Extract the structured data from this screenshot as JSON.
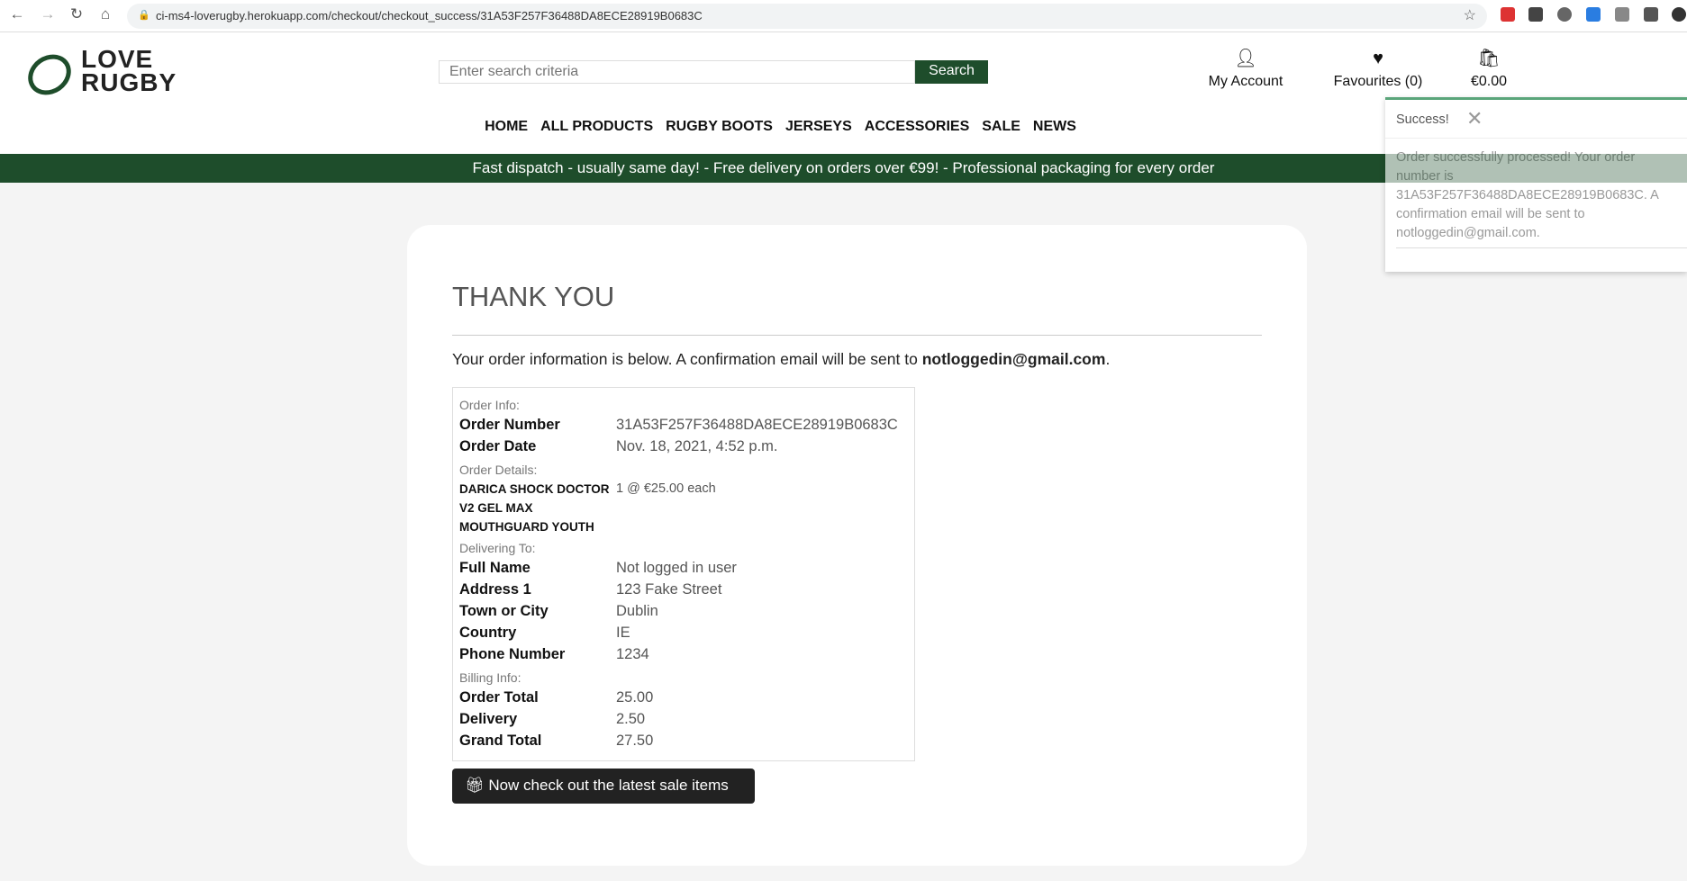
{
  "browser": {
    "url": "ci-ms4-loverugby.herokuapp.com/checkout/checkout_success/31A53F257F36488DA8ECE28919B0683C"
  },
  "header": {
    "logo": "LOVE RUGBY",
    "logo_line1": "LOVE",
    "logo_line2": "RUGBY",
    "search_placeholder": "Enter search criteria",
    "search_label": "Search",
    "account": "My Account",
    "favourites": "Favourites (0)",
    "cart": "€0.00"
  },
  "nav": [
    "HOME",
    "ALL PRODUCTS",
    "RUGBY BOOTS",
    "JERSEYS",
    "ACCESSORIES",
    "SALE",
    "NEWS"
  ],
  "banner": "Fast dispatch - usually same day! - Free delivery on orders over €99! - Professional packaging for every order",
  "main": {
    "title": "THANK YOU",
    "intro": "Your order information is below. A confirmation email will be sent to ",
    "email": "notloggedin@gmail.com",
    "intro_end": ".",
    "order_info": "Order Info:",
    "order_number_label": "Order Number",
    "order_number": "31A53F257F36488DA8ECE28919B0683C",
    "order_date_label": "Order Date",
    "order_date": "Nov. 18, 2021, 4:52 p.m.",
    "order_details": "Order Details:",
    "product": "DARICA SHOCK DOCTOR V2 GEL MAX MOUTHGUARD YOUTH",
    "product_qty": "1 @ €25.00 each",
    "delivering_to": "Delivering To:",
    "full_name_label": "Full Name",
    "full_name": "Not logged in user",
    "address_label": "Address 1",
    "address": "123 Fake Street",
    "town_label": "Town or City",
    "town": "Dublin",
    "country_label": "Country",
    "country": "IE",
    "phone_label": "Phone Number",
    "phone": "1234",
    "billing": "Billing Info:",
    "order_total_label": "Order Total",
    "order_total": "25.00",
    "delivery_label": "Delivery",
    "delivery": "2.50",
    "grand_total_label": "Grand Total",
    "grand_total": "27.50",
    "sale_button": "Now check out the latest sale items"
  },
  "toast": {
    "title": "Success!",
    "message": "Order successfully processed! Your order number is 31A53F257F36488DA8ECE28919B0683C. A confirmation email will be sent to notloggedin@gmail.com."
  },
  "colors": {
    "brand": "#1e4d2b",
    "toast_accent": "#5aa57a"
  }
}
